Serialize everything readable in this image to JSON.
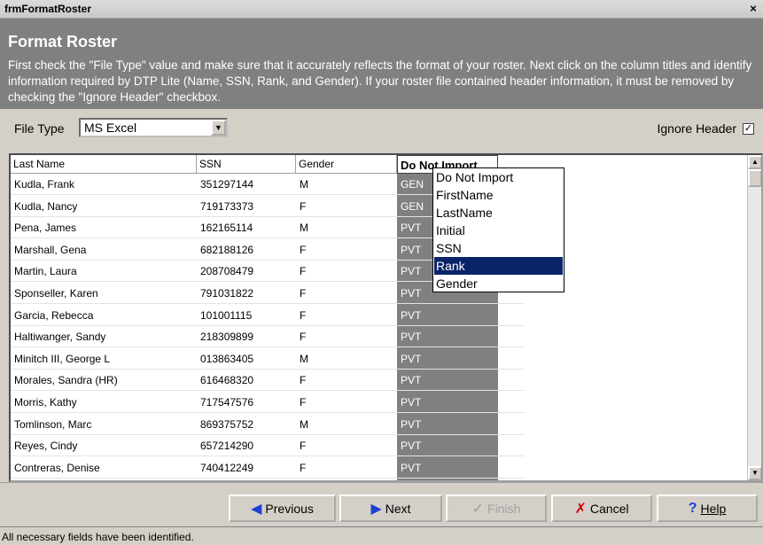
{
  "window": {
    "title": "frmFormatRoster",
    "close_glyph": "×"
  },
  "header": {
    "title": "Format Roster",
    "description": "First check the \"File Type\" value and make sure that it accurately reflects the format of your roster.  Next click on the column titles and identify information required by DTP Lite (Name, SSN, Rank, and Gender).  If your roster file contained header information, it must be removed by checking the \"Ignore Header\" checkbox."
  },
  "toolbar": {
    "file_type_label": "File Type",
    "file_type_value": "MS Excel",
    "ignore_header_label": "Ignore Header",
    "ignore_header_checked": true
  },
  "grid": {
    "columns": [
      "Last Name",
      "SSN",
      "Gender",
      "Do Not Import"
    ],
    "rows": [
      [
        "Kudla, Frank",
        "351297144",
        "M",
        "GEN"
      ],
      [
        "Kudla, Nancy",
        "719173373",
        "F",
        "GEN"
      ],
      [
        "Pena, James",
        "162165114",
        "M",
        "PVT"
      ],
      [
        "Marshall, Gena",
        "682188126",
        "F",
        "PVT"
      ],
      [
        "Martin,  Laura",
        "208708479",
        "F",
        "PVT"
      ],
      [
        "Sponseller, Karen",
        "791031822",
        "F",
        "PVT"
      ],
      [
        "Garcia, Rebecca",
        "101001115",
        "F",
        "PVT"
      ],
      [
        "Haltiwanger, Sandy",
        "218309899",
        "F",
        "PVT"
      ],
      [
        "Minitch III, George L",
        "013863405",
        "M",
        "PVT"
      ],
      [
        "Morales, Sandra (HR)",
        "616468320",
        "F",
        "PVT"
      ],
      [
        "Morris, Kathy",
        "717547576",
        "F",
        "PVT"
      ],
      [
        "Tomlinson, Marc",
        "869375752",
        "M",
        "PVT"
      ],
      [
        "Reyes, Cindy",
        "657214290",
        "F",
        "PVT"
      ],
      [
        "Contreras, Denise",
        "740412249",
        "F",
        "PVT"
      ]
    ]
  },
  "dropdown": {
    "options": [
      "Do Not Import",
      "FirstName",
      "LastName",
      "Initial",
      "SSN",
      "Rank",
      "Gender"
    ],
    "selected_index": 5
  },
  "buttons": {
    "previous": "Previous",
    "next": "Next",
    "finish": "Finish",
    "cancel": "Cancel",
    "help": "Help"
  },
  "status": {
    "text": "All necessary fields have been identified."
  },
  "colors": {
    "header_bg": "#808080",
    "selection": "#0a246a",
    "arrow_blue": "#1f3fd0",
    "cancel_red": "#cc0000"
  }
}
